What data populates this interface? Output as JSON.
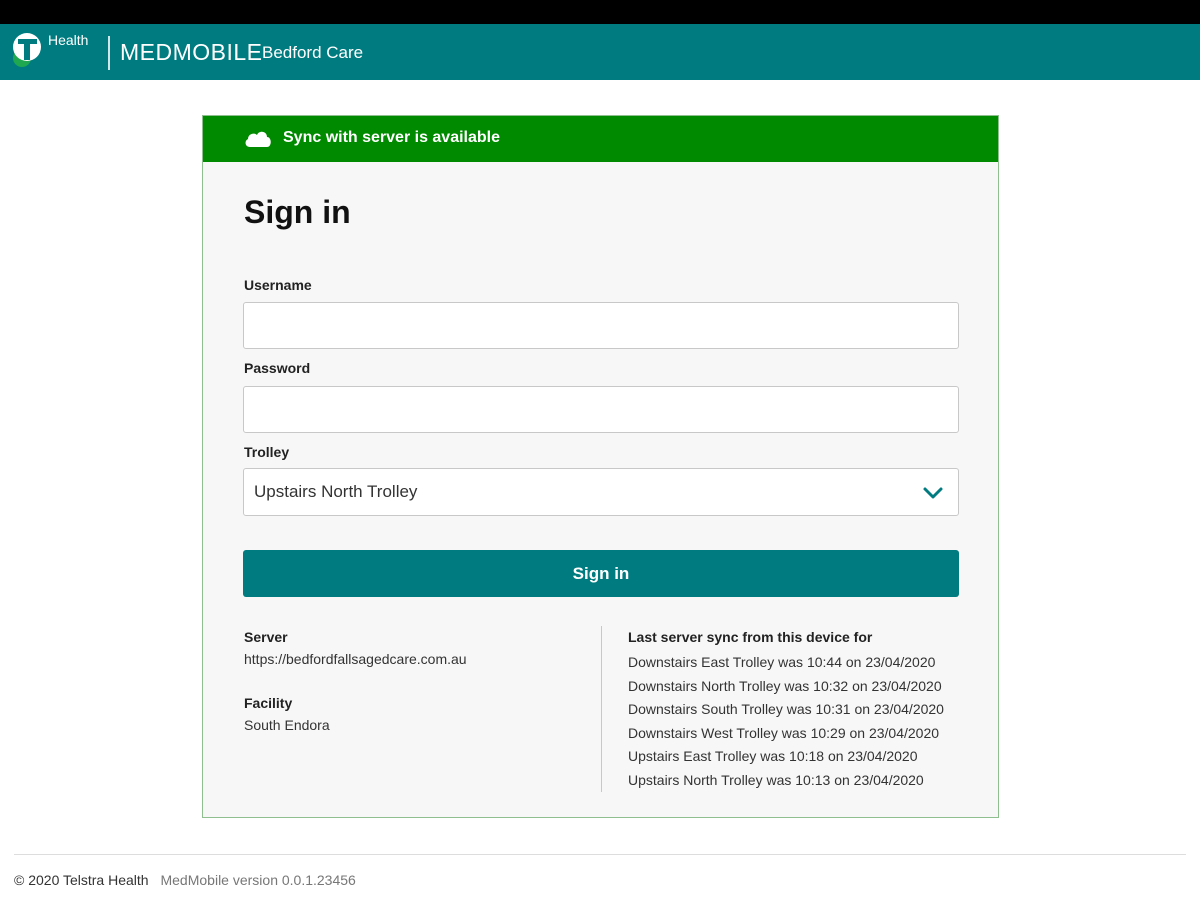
{
  "header": {
    "logo_icon": "telstra-t-logo",
    "health_label": "Health",
    "brand": "MEDMOBILE",
    "facility": "Bedford Care",
    "color": "#007c80"
  },
  "banner": {
    "icon": "cloud-icon",
    "text": "Sync with server is available",
    "color": "#008a00"
  },
  "form": {
    "title": "Sign in",
    "username_label": "Username",
    "username_value": "",
    "password_label": "Password",
    "password_value": "",
    "trolley_label": "Trolley",
    "trolley_selected": "Upstairs North Trolley",
    "trolley_icon": "chevron-down-icon",
    "submit_label": "Sign in"
  },
  "info": {
    "server_label": "Server",
    "server_value": "https://bedfordfallsagedcare.com.au",
    "facility_label": "Facility",
    "facility_value": "South Endora",
    "sync_heading": "Last server sync from this device for",
    "sync_entries": [
      "Downstairs East Trolley was 10:44 on 23/04/2020",
      "Downstairs North Trolley was 10:32 on 23/04/2020",
      "Downstairs South Trolley was 10:31 on 23/04/2020",
      "Downstairs West Trolley was 10:29 on 23/04/2020",
      "Upstairs East Trolley was 10:18 on 23/04/2020",
      "Upstairs North Trolley was 10:13 on 23/04/2020"
    ]
  },
  "footer": {
    "copyright": "© 2020 Telstra Health",
    "version": "MedMobile version 0.0.1.23456"
  }
}
